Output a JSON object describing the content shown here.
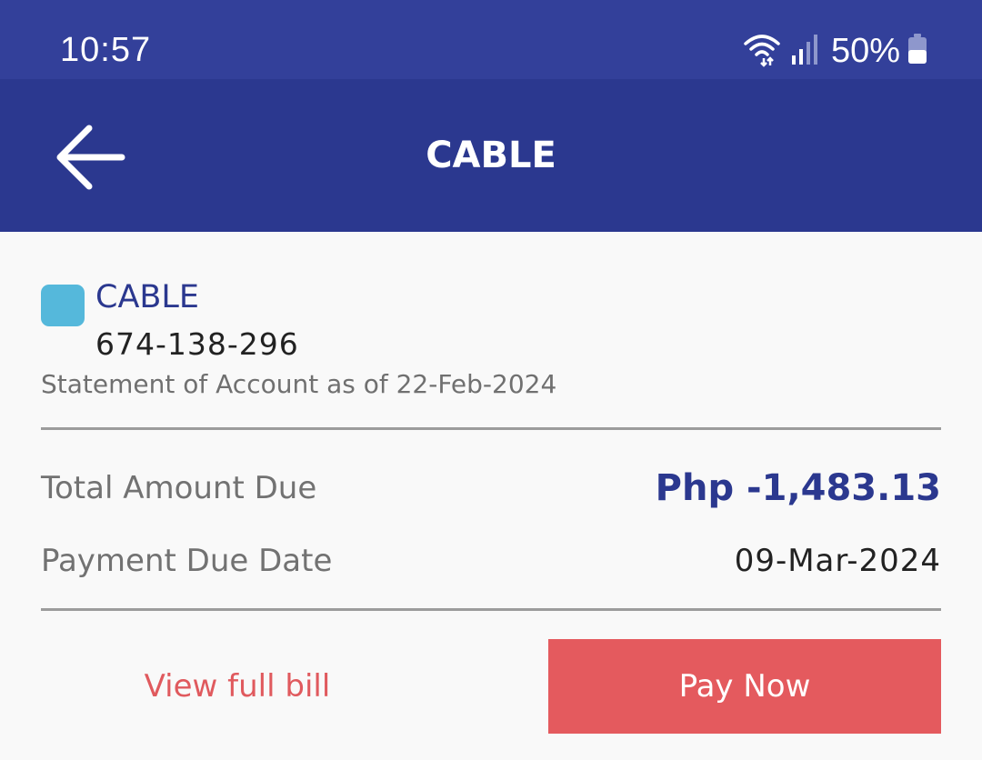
{
  "status_bar": {
    "time": "10:57",
    "battery": "50%",
    "icons": [
      "wifi-icon",
      "signal-icon",
      "battery-icon"
    ]
  },
  "app_bar": {
    "title": "CABLE",
    "back_icon": "arrow-left-icon"
  },
  "account": {
    "provider": "CABLE",
    "account_number": "674-138-296",
    "statement": "Statement of Account as of 22-Feb-2024",
    "badge_color": "#55b8db"
  },
  "summary": {
    "total_label": "Total Amount Due",
    "total_value": "Php -1,483.13",
    "due_label": "Payment Due Date",
    "due_value": "09-Mar-2024"
  },
  "actions": {
    "view_bill": "View full bill",
    "pay_now": "Pay Now"
  },
  "colors": {
    "primary": "#2b388f",
    "status_bar": "#33409a",
    "accent": "#e45a5e"
  }
}
